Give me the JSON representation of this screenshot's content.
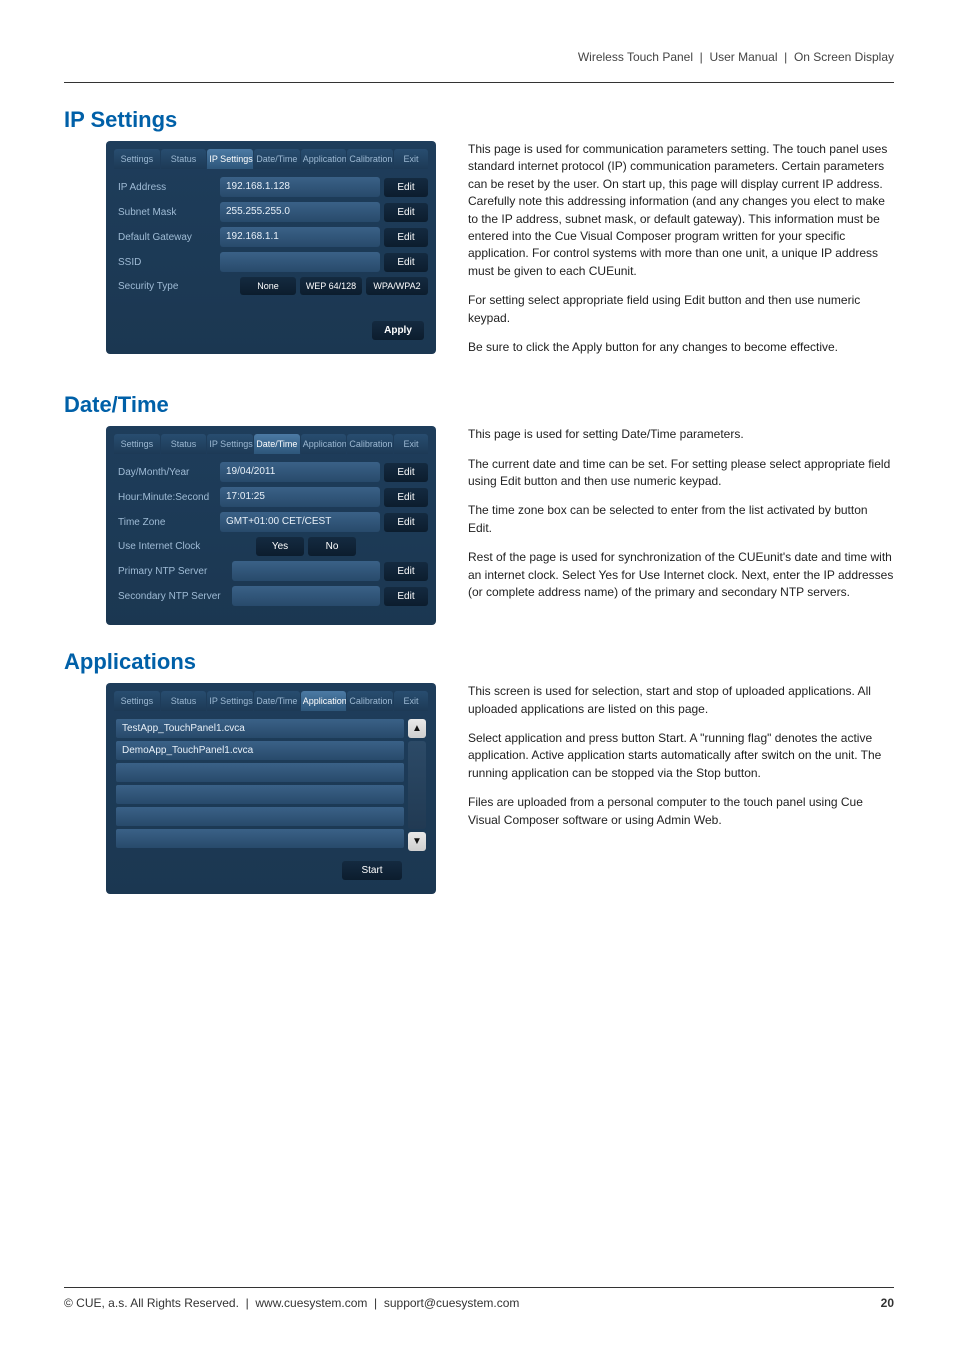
{
  "header": {
    "product": "Wireless Touch Panel",
    "doc": "User Manual",
    "section": "On Screen Display"
  },
  "tabs": {
    "settings": "Settings",
    "status": "Status",
    "ip": "IP Settings",
    "datetime": "Date/Time",
    "applications": "Applications",
    "calibration": "Calibration",
    "exit": "Exit"
  },
  "ip_section": {
    "title": "IP Settings",
    "rows": {
      "ip_label": "IP Address",
      "ip_value": "192.168.1.128",
      "mask_label": "Subnet Mask",
      "mask_value": "255.255.255.0",
      "gw_label": "Default Gateway",
      "gw_value": "192.168.1.1",
      "ssid_label": "SSID",
      "ssid_value": "",
      "sec_label": "Security Type"
    },
    "security": {
      "none": "None",
      "wep": "WEP 64/128",
      "wpa": "WPA/WPA2"
    },
    "edit": "Edit",
    "apply": "Apply",
    "text": {
      "p1": "This page is used for communication parameters setting. The touch panel uses standard internet protocol (IP) communication parameters. Certain parameters can be reset by the user. On start up, this page will display current IP address. Carefully note this addressing information (and any changes you elect to make to the IP address, subnet mask, or default gateway). This information must be entered into the Cue Visual Composer program written for your specific application. For control systems with more than one unit, a unique IP address must be given to each CUEunit.",
      "p2": "For setting select appropriate field using Edit button and then use numeric keypad.",
      "p3": "Be sure to click the Apply button for any changes to become effective."
    }
  },
  "dt_section": {
    "title": "Date/Time",
    "rows": {
      "dmy_label": "Day/Month/Year",
      "dmy_value": "19/04/2011",
      "hms_label": "Hour:Minute:Second",
      "hms_value": "17:01:25",
      "tz_label": "Time Zone",
      "tz_value": "GMT+01:00 CET/CEST",
      "uic_label": "Use Internet Clock",
      "yes": "Yes",
      "no": "No",
      "pntp_label": "Primary NTP Server",
      "pntp_value": "",
      "sntp_label": "Secondary NTP Server",
      "sntp_value": ""
    },
    "edit": "Edit",
    "text": {
      "p1": "This page is used for setting Date/Time parameters.",
      "p2": "The current date and time can be set. For setting please select appropriate field using Edit button and then use numeric keypad.",
      "p3": "The time zone box can be selected to enter from the list activated by button Edit.",
      "p4": "Rest of the page is used for synchronization of the CUEunit's date and time with an internet clock. Select Yes for Use Internet clock. Next, enter the IP addresses (or complete address name) of the primary and secondary NTP servers."
    }
  },
  "app_section": {
    "title": "Applications",
    "items": [
      "TestApp_TouchPanel1.cvca",
      "DemoApp_TouchPanel1.cvca",
      "",
      "",
      "",
      ""
    ],
    "start": "Start",
    "text": {
      "p1": "This screen is used for selection, start and stop of uploaded applications. All uploaded applications are listed on this page.",
      "p2": "Select application and press button Start. A \"running flag\" denotes the active application. Active application starts automatically after switch on the unit. The running application can be stopped via the Stop button.",
      "p3": "Files are uploaded from a personal computer to the touch panel using Cue Visual Composer software or using Admin Web."
    }
  },
  "footer": {
    "left_copyright": "© CUE, a.s. All Rights Reserved.",
    "left_site": "www.cuesystem.com",
    "left_email": "support@cuesystem.com",
    "page": "20"
  }
}
